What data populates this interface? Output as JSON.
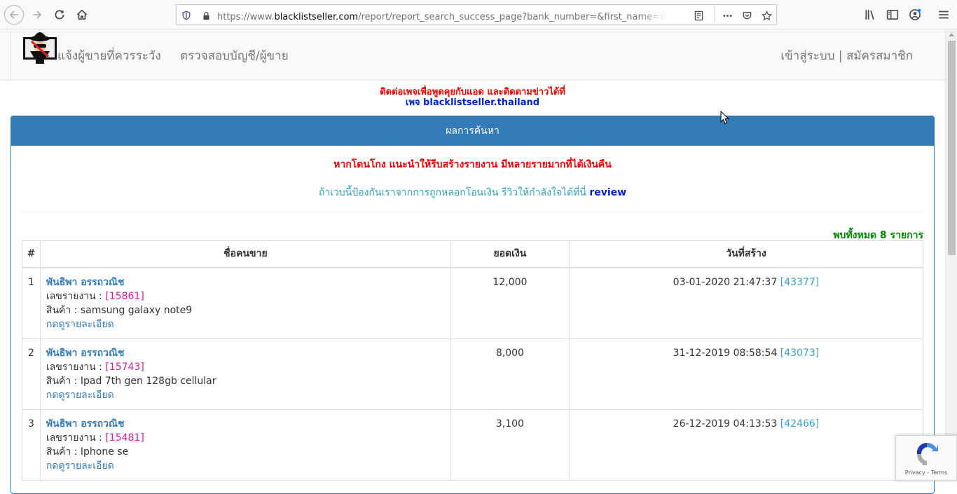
{
  "browser": {
    "url_prefix": "https://www.",
    "url_domain": "blacklistseller.com",
    "url_rest": "/report/report_search_success_page?bank_number=&first_name=พันธิพา&"
  },
  "navbar": {
    "brand_label": "แจ้งผู้ขายที่ควรระวัง",
    "check_label": "ตรวจสอบบัญชี/ผู้ขาย",
    "login_label": "เข้าสู่ระบบ | สมัครสมาชิก"
  },
  "notice": {
    "line1": "ติดต่อเพจเพื่อพูดคุยกับแอด และติดตามข่าวได้ที่",
    "line2": "เพจ blacklistseller.thailand"
  },
  "panel": {
    "heading": "ผลการค้นหา",
    "warning": "หากโดนโกง แนะนำให้รีบสร้างรายงาน มีหลายรายมากที่ได้เงินคืน",
    "review_text": "ถ้าเวบนี้ป้องกันเราจากการถูกหลอกโอนเงิน รีวิวให้กำลังใจได้ที่นี่",
    "review_link": "review",
    "count_text": "พบทั้งหมด 8 รายการ"
  },
  "table": {
    "headers": [
      "#",
      "ชื่อคนขาย",
      "ยอดเงิน",
      "วันที่สร้าง"
    ],
    "rows": [
      {
        "num": "1",
        "seller": "พันธิพา อรรถวณิช",
        "report_label": "เลขรายงาน : ",
        "report_no": "[15861]",
        "product": "สินค้า : samsung galaxy note9",
        "detail": "กดดูรายละเอียด",
        "amount": "12,000",
        "date": "03-01-2020 21:47:37 ",
        "date_id": "[43377]"
      },
      {
        "num": "2",
        "seller": "พันธิพา อรรถวณิช",
        "report_label": "เลขรายงาน : ",
        "report_no": "[15743]",
        "product": "สินค้า : Ipad 7th gen 128gb cellular",
        "detail": "กดดูรายละเอียด",
        "amount": "8,000",
        "date": "31-12-2019 08:58:54 ",
        "date_id": "[43073]"
      },
      {
        "num": "3",
        "seller": "พันธิพา อรรถวณิช",
        "report_label": "เลขรายงาน : ",
        "report_no": "[15481]",
        "product": "สินค้า : Iphone se",
        "detail": "กดดูรายละเอียด",
        "amount": "3,100",
        "date": "26-12-2019 04:13:53 ",
        "date_id": "[42466]"
      }
    ]
  },
  "recaptcha": {
    "terms": "Privacy - Terms"
  }
}
